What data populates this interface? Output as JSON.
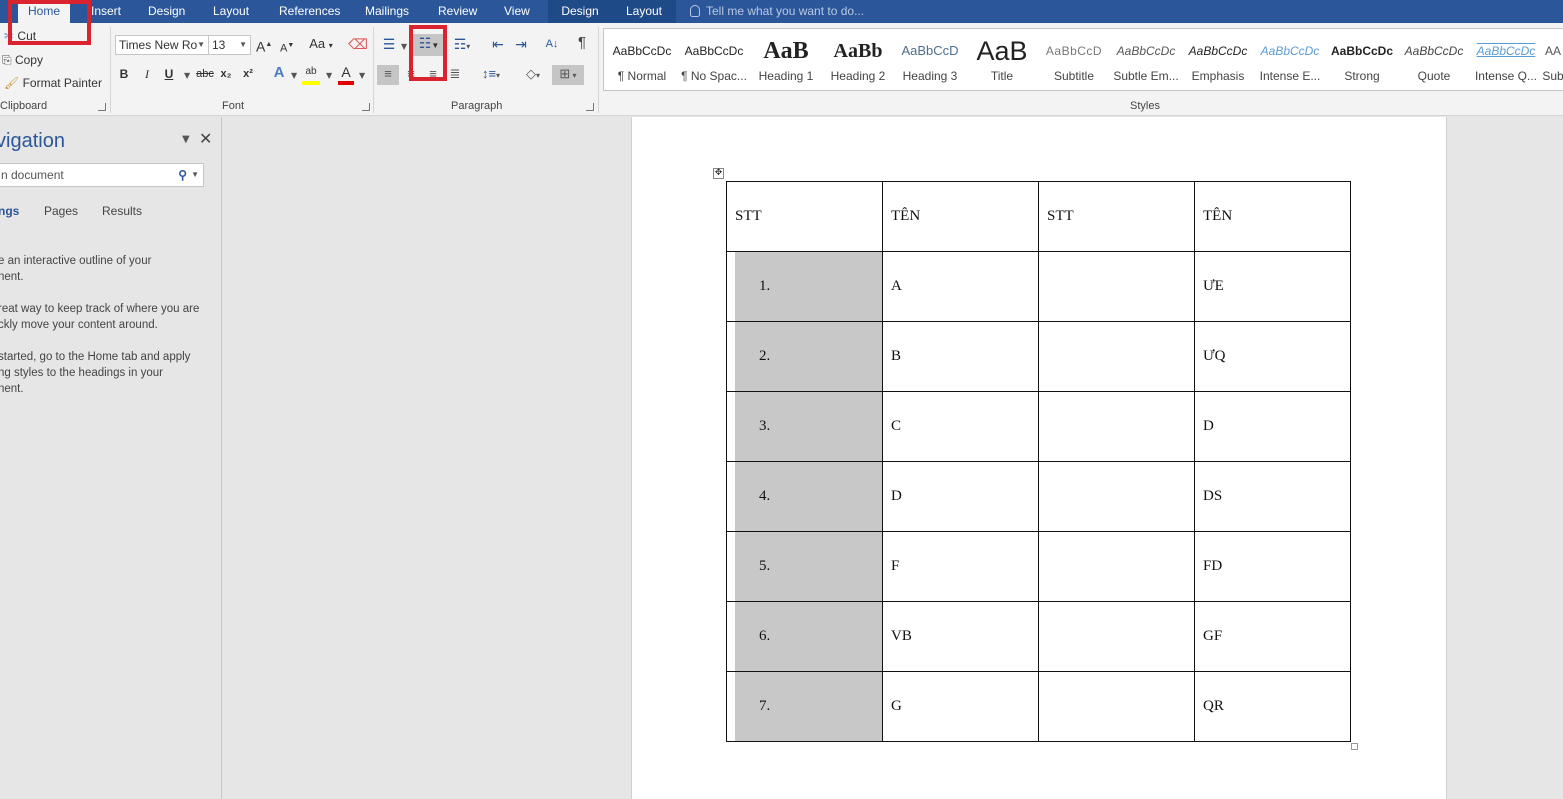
{
  "tabs": [
    {
      "label": "Home",
      "active": true
    },
    {
      "label": "Insert"
    },
    {
      "label": "Design"
    },
    {
      "label": "Layout"
    },
    {
      "label": "References"
    },
    {
      "label": "Mailings"
    },
    {
      "label": "Review"
    },
    {
      "label": "View"
    },
    {
      "label": "Design",
      "contextual": true
    },
    {
      "label": "Layout",
      "contextual": true
    }
  ],
  "tell_me": "Tell me what you want to do...",
  "clipboard": {
    "label": "Clipboard",
    "cut": "Cut",
    "copy": "Copy",
    "format_painter": "Format Painter"
  },
  "font": {
    "label": "Font",
    "family": "Times New Ro",
    "size": "13",
    "grow": "A",
    "shrink": "A",
    "change_case": "Aa",
    "bold": "B",
    "italic": "I",
    "underline": "U",
    "strike": "abc",
    "subscript": "x₂",
    "superscript": "x²",
    "text_effects": "A",
    "highlight": "ab",
    "font_color": "A",
    "highlight_color": "#ffff00",
    "font_color_value": "#e00000"
  },
  "paragraph": {
    "label": "Paragraph",
    "pilcrow": "¶",
    "sort": "A↓"
  },
  "styles": {
    "label": "Styles",
    "items": [
      {
        "preview": "AaBbCcDc",
        "name": "¶ Normal"
      },
      {
        "preview": "AaBbCcDc",
        "name": "¶ No Spac..."
      },
      {
        "preview": "AaB",
        "name": "Heading 1"
      },
      {
        "preview": "AaBb",
        "name": "Heading 2"
      },
      {
        "preview": "AaBbCcD",
        "name": "Heading 3"
      },
      {
        "preview": "AaB",
        "name": "Title"
      },
      {
        "preview": "AaBbCcD",
        "name": "Subtitle"
      },
      {
        "preview": "AaBbCcDc",
        "name": "Subtle Em..."
      },
      {
        "preview": "AaBbCcDc",
        "name": "Emphasis"
      },
      {
        "preview": "AaBbCcDc",
        "name": "Intense E..."
      },
      {
        "preview": "AaBbCcDc",
        "name": "Strong"
      },
      {
        "preview": "AaBbCcDc",
        "name": "Quote"
      },
      {
        "preview": "AaBbCcDc",
        "name": "Intense Q..."
      },
      {
        "preview": "AA",
        "name": "Sub"
      }
    ]
  },
  "navigation": {
    "title": "vigation",
    "search_placeholder": "n document",
    "tabs": [
      {
        "label": "ngs",
        "active": true
      },
      {
        "label": "Pages"
      },
      {
        "label": "Results"
      }
    ],
    "help_lines": [
      "e an interactive outline of your",
      "nent.",
      "reat way to keep track of where you are",
      "ckly move your content around.",
      "started, go to the Home tab and apply",
      "ng styles to the headings in your",
      "nent."
    ]
  },
  "document": {
    "table": {
      "headers": [
        "STT",
        "TÊN",
        "STT",
        "TÊN"
      ],
      "rows": [
        [
          "1.",
          "A",
          "",
          "ƯE"
        ],
        [
          "2.",
          "B",
          "",
          "ƯQ"
        ],
        [
          "3.",
          "C",
          "",
          "D"
        ],
        [
          "4.",
          "D",
          "",
          "DS"
        ],
        [
          "5.",
          "F",
          "",
          "FD"
        ],
        [
          "6.",
          "VB",
          "",
          "GF"
        ],
        [
          "7.",
          "G",
          "",
          "QR"
        ]
      ]
    }
  },
  "colors": {
    "accent": "#2b579a",
    "annotation": "#d9232e",
    "selection_shade": "#c8c8c8"
  }
}
